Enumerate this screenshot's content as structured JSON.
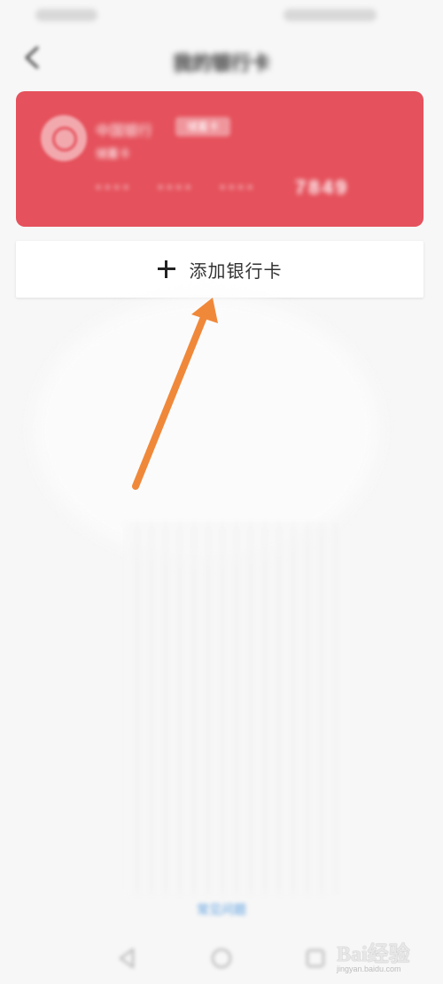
{
  "statusbar": {},
  "header": {
    "title": "我的银行卡"
  },
  "card": {
    "bank_name": "中国银行",
    "tag": "储蓄卡",
    "card_type": "储蓄卡",
    "number_groups": [
      "····",
      "····",
      "····",
      "7849"
    ],
    "color": "#e5515c"
  },
  "add_card": {
    "label": "添加银行卡",
    "icon": "plus-icon"
  },
  "bottom_link": "常见问题",
  "annotation": {
    "color": "#f0883a"
  },
  "navbar": {
    "icons": [
      "back-triangle-icon",
      "home-circle-icon",
      "recents-square-icon"
    ]
  },
  "watermark": {
    "text": "Bai经验",
    "sub": "jingyan.baidu.com"
  }
}
